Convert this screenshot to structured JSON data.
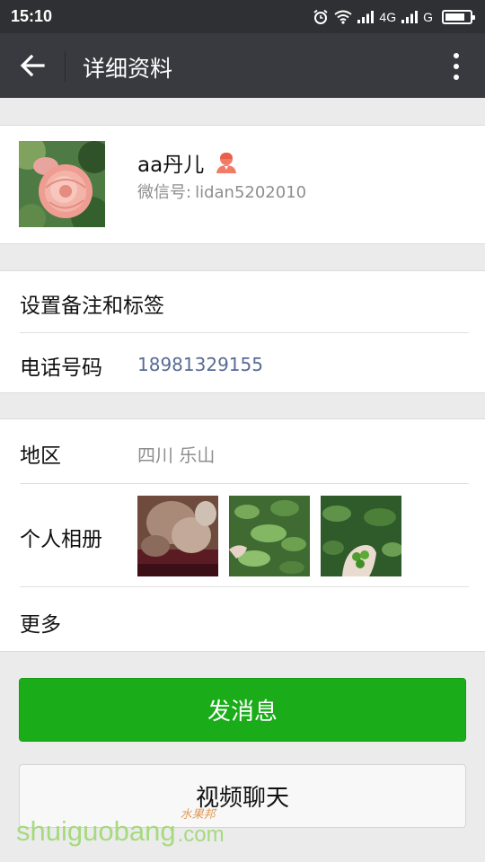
{
  "status_bar": {
    "time": "15:10",
    "network_1": "4G",
    "network_2": "G",
    "icons": [
      "alarm-icon",
      "wifi-icon",
      "signal-icon",
      "signal-icon",
      "battery-icon"
    ]
  },
  "title_bar": {
    "title": "详细资料",
    "back_icon": "arrow-left-icon",
    "more_icon": "more-vertical-icon"
  },
  "profile": {
    "nickname": "aa丹儿",
    "gender_icon": "female-icon",
    "wechat_id_label": "微信号:",
    "wechat_id": "lidan5202010"
  },
  "info": {
    "remark_label": "设置备注和标签",
    "phone_label": "电话号码",
    "phone_value": "18981329155"
  },
  "details": {
    "region_label": "地区",
    "region_value": "四川  乐山",
    "album_label": "个人相册",
    "more_label": "更多"
  },
  "actions": {
    "send_message": "发消息",
    "video_chat": "视频聊天"
  },
  "watermark": {
    "text": "shuiguobang",
    "suffix": ".com",
    "cn": "水果邦"
  },
  "colors": {
    "title_bar": "#393a3f",
    "status_bar": "#2f3033",
    "primary_green": "#1aad19",
    "link_blue": "#576b95",
    "background": "#ebebeb"
  }
}
